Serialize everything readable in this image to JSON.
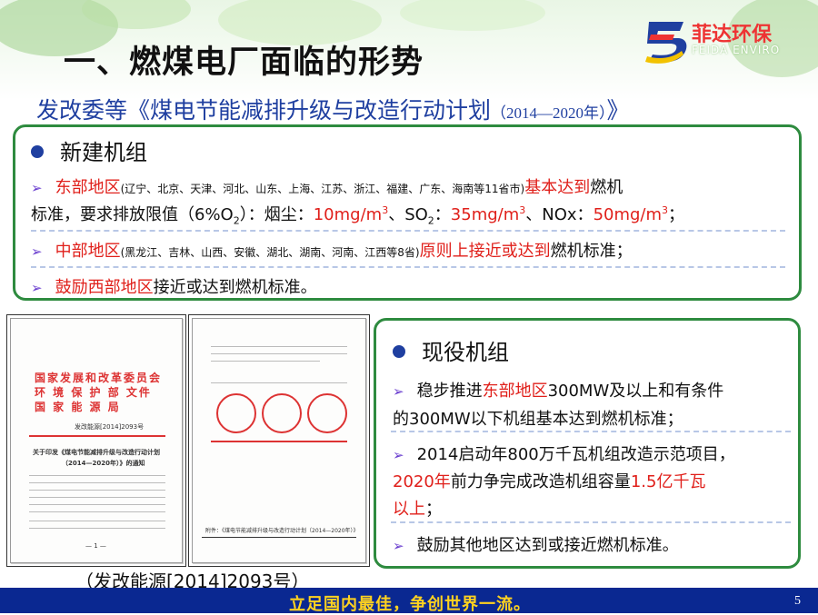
{
  "header": {
    "title": "一、燃煤电厂面临的形势",
    "logo_cn": "菲达环保",
    "logo_en": "FEIDA ENVIRO"
  },
  "subtitle": {
    "main": "发改委等《煤电节能减排升级与改造行动计划",
    "years": "（2014—2020年）",
    "close": "》"
  },
  "new_units": {
    "heading": "新建机组",
    "east_label": "东部地区",
    "east_provinces": "(辽宁、北京、天津、河北、山东、上海、江苏、浙江、福建、广东、海南等11省市)",
    "east_basic": "基本达到",
    "east_text1": "燃机",
    "east_text2": "标准，要求排放限值（6%O",
    "east_o2_sub": "2",
    "east_text3": "）：烟尘：",
    "dust": "10mg/m",
    "so2_label": "、SO",
    "so2_sub": "2",
    "so2_colon": "：",
    "so2": "35mg/m",
    "nox_label": "、NOx：",
    "nox": "50mg/m",
    "cube": "3",
    "end": "；",
    "central_label": "中部地区",
    "central_provinces": "(黑龙江、吉林、山西、安徽、湖北、湖南、河南、江西等8省)",
    "central_principle": "原则上接近或达到",
    "central_text": "燃机标准；",
    "west_label": "鼓励西部地区",
    "west_text": "接近或达到燃机标准。"
  },
  "existing_units": {
    "heading": "现役机组",
    "item1_a": "稳步推进",
    "item1_red": "东部地区",
    "item1_b": "300MW及以上和有条件",
    "item1_c": "的300MW以下机组基本达到燃机标准；",
    "item2_a": "2014启动年800万千瓦机组改造示范项目，",
    "item2_red1": "2020年",
    "item2_b": "前力争完成改造机组容量",
    "item2_red2": "1.5亿千瓦",
    "item2_red3": "以上",
    "item2_c": "；",
    "item3": "鼓励其他地区达到或接近燃机标准。"
  },
  "document": {
    "org1": "国家发展和改革委员会",
    "org2": "环 境 保 护 部 文件",
    "org3": "国 家 能 源 局",
    "doc_no": "发改能源[2014]2093号",
    "notice": "关于印发《煤电节能减排升级与改造行动计划",
    "notice2": "（2014—2020年）》的通知",
    "page_mark": "— 1 —",
    "attach": "附件：《煤电节能减排升级与改造行动计划（2014—2020年）》"
  },
  "caption": "（发改能源[2014]2093号）",
  "footer": {
    "slogan": "立足国内最佳，争创世界一流。",
    "page": "5"
  },
  "colors": {
    "accent_blue": "#1f3fa0",
    "highlight_red": "#e0201b",
    "frame_green": "#2e8b3f",
    "footer_blue": "#0a2891",
    "slogan_yellow": "#ffd21f"
  }
}
